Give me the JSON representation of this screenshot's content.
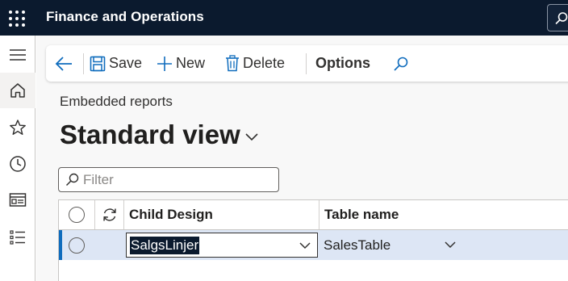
{
  "app": {
    "title": "Finance and Operations"
  },
  "icons": {
    "waffle": "app-launcher-icon",
    "search": "search-icon",
    "hamburger": "hamburger-icon",
    "home": "home-icon",
    "star": "star-icon",
    "clock": "clock-icon",
    "workspace": "workspace-icon",
    "modules": "modules-list-icon",
    "back": "back-arrow-icon",
    "save": "save-icon",
    "new": "plus-icon",
    "delete": "trash-icon",
    "chevron": "chevron-down-icon",
    "refresh": "refresh-icon"
  },
  "colors": {
    "topbar": "#0b1a2e",
    "accent": "#0f6cbd",
    "row_selected": "#dde6f5"
  },
  "actionbar": {
    "save_label": "Save",
    "new_label": "New",
    "delete_label": "Delete",
    "options_label": "Options"
  },
  "page": {
    "breadcrumb": "Embedded reports",
    "view_title": "Standard view"
  },
  "filter": {
    "placeholder": "Filter",
    "value": ""
  },
  "grid": {
    "columns": [
      "Child Design",
      "Table name"
    ],
    "rows": [
      {
        "child_design": "SalgsLinjer",
        "table_name": "SalesTable"
      }
    ]
  }
}
